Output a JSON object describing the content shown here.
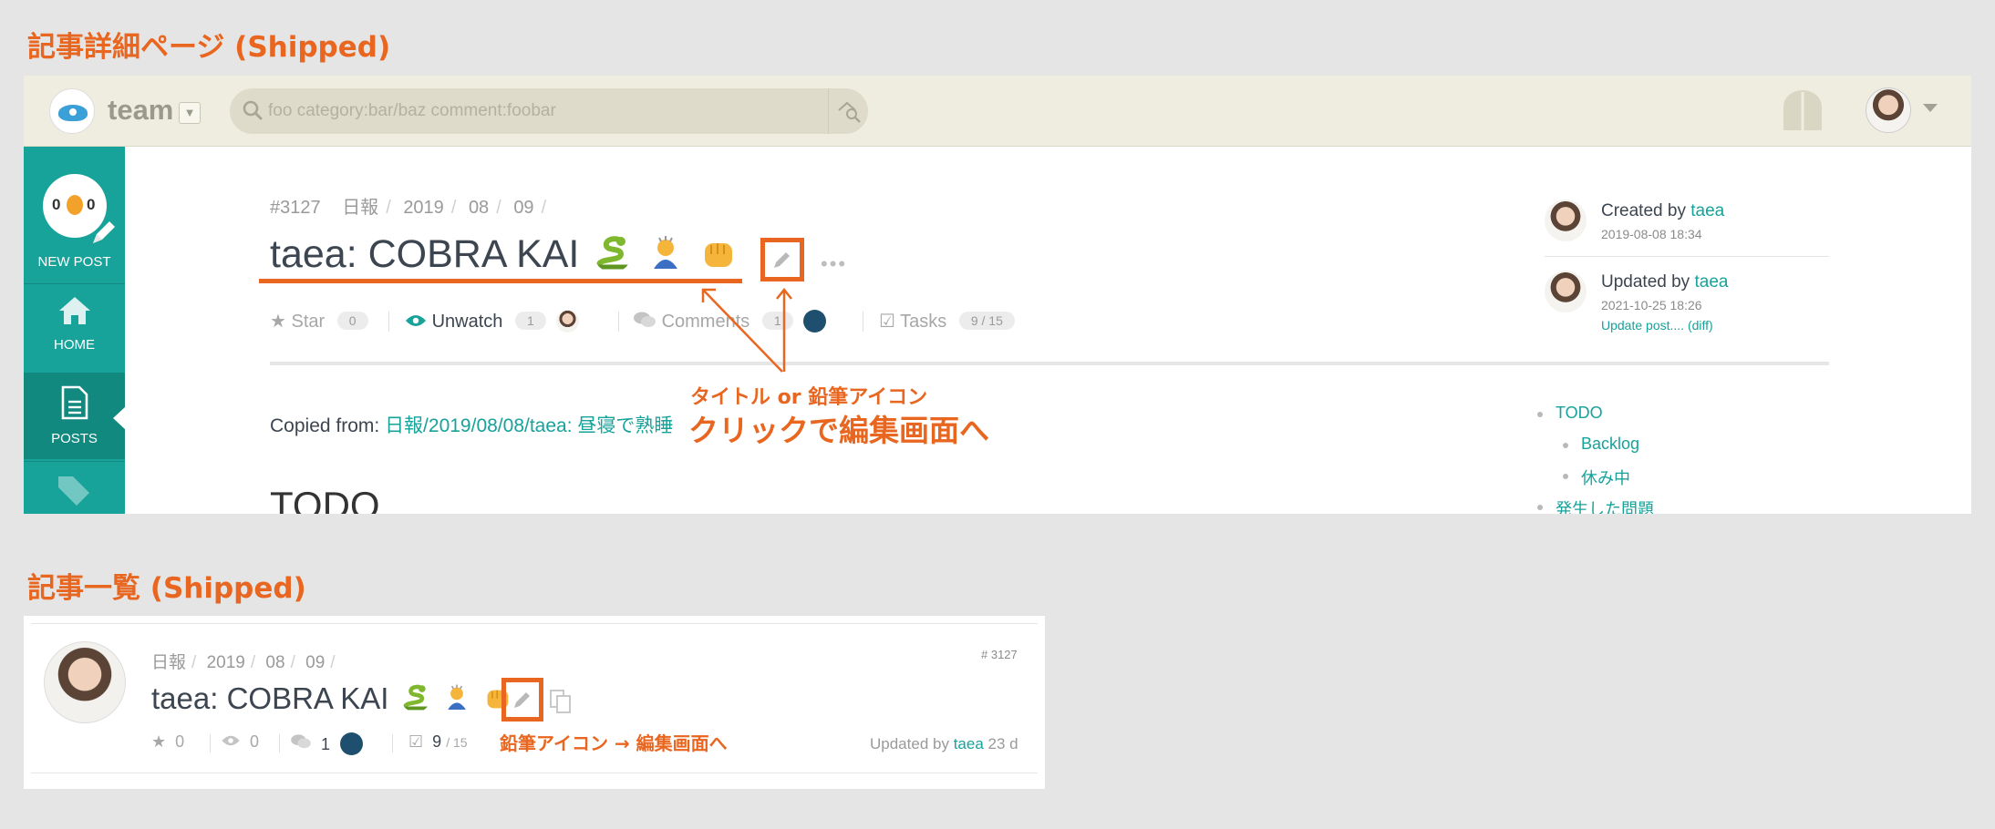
{
  "section_titles": {
    "detail": "記事詳細ページ (Shipped)",
    "list": "記事一覧 (Shipped)"
  },
  "colors": {
    "accent_orange": "#e8661f",
    "brand_teal": "#17a29a",
    "topbar_bg": "#efede0"
  },
  "detail": {
    "topbar": {
      "team_name": "team",
      "search_placeholder": "foo category:bar/baz comment:foobar"
    },
    "sidebar": {
      "new_post": {
        "count_left": "0",
        "count_right": "0",
        "label": "NEW POST"
      },
      "home_label": "HOME",
      "posts_label": "POSTS"
    },
    "breadcrumb": [
      "#3127",
      "日報",
      "2019",
      "08",
      "09"
    ],
    "title": "taea: COBRA KAI",
    "title_emojis": [
      "snake-emoji",
      "person-bowing-emoji",
      "fist-emoji"
    ],
    "actions": {
      "star_label": "Star",
      "star_count": "0",
      "watch_label": "Unwatch",
      "watch_count": "1",
      "comments_label": "Comments",
      "comments_count": "1",
      "tasks_label": "Tasks",
      "tasks_count": "9 / 15"
    },
    "copied_label": "Copied from:",
    "copied_link": "日報/2019/08/08/taea: 昼寝で熟睡",
    "heading_partial": "TODO",
    "meta": {
      "created_prefix": "Created by",
      "created_user": "taea",
      "created_at": "2019-08-08 18:34",
      "updated_prefix": "Updated by",
      "updated_user": "taea",
      "updated_at": "2021-10-25 18:26",
      "update_message": "Update post.... (diff)"
    },
    "toc": [
      "TODO",
      "Backlog",
      "休み中",
      "発生した問題"
    ],
    "annotation_small": "タイトル or 鉛筆アイコン",
    "annotation_big": "クリックで編集画面へ"
  },
  "list": {
    "breadcrumb": [
      "日報",
      "2019",
      "08",
      "09"
    ],
    "title": "taea: COBRA KAI",
    "post_number": "# 3127",
    "stats": {
      "stars": "0",
      "watchers": "0",
      "comments": "1",
      "tasks_done": "9",
      "tasks_total": "/ 15"
    },
    "annotation": "鉛筆アイコン → 編集画面へ",
    "updated_prefix": "Updated by",
    "updated_user": "taea",
    "updated_ago": "23 d"
  }
}
